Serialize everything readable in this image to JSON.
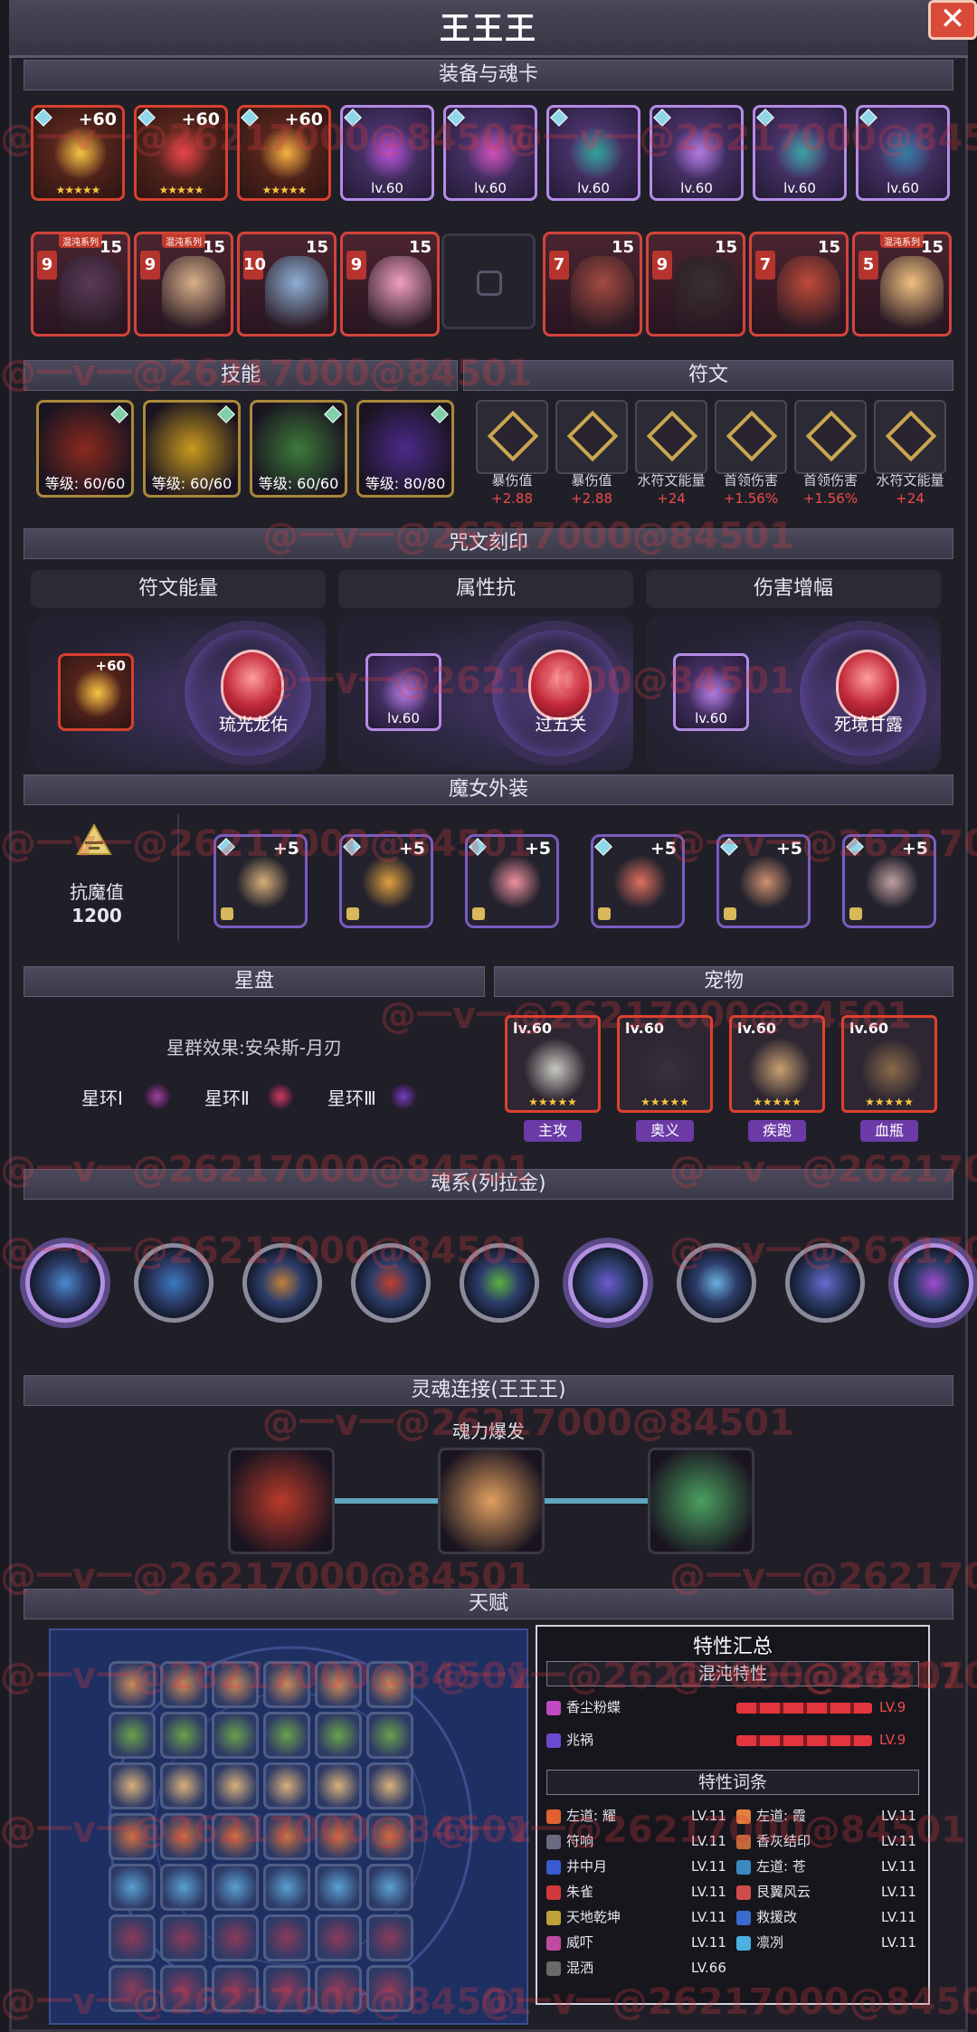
{
  "title": "王王王",
  "close_label": "✕",
  "sections": {
    "equip_soul": "装备与魂卡",
    "skills": "技能",
    "runes": "符文",
    "curse": "咒文刻印",
    "outfit": "魔女外装",
    "star": "星盘",
    "pet": "宠物",
    "soul_system": "魂系(列拉金)",
    "soul_link": "灵魂连接(王王王)",
    "talent": "天赋"
  },
  "gear": [
    {
      "label": "+60",
      "kind": "plus",
      "color": "#f5c542"
    },
    {
      "label": "+60",
      "kind": "plus",
      "color": "#e8434a"
    },
    {
      "label": "+60",
      "kind": "plus",
      "color": "#f5b342"
    },
    {
      "label": "lv.60",
      "kind": "lv",
      "color": "#b84fd6"
    },
    {
      "label": "lv.60",
      "kind": "lv",
      "color": "#d04fb8"
    },
    {
      "label": "lv.60",
      "kind": "lv",
      "color": "#2fa59a"
    },
    {
      "label": "lv.60",
      "kind": "lv",
      "color": "#b17be0"
    },
    {
      "label": "lv.60",
      "kind": "lv",
      "color": "#3aa3a3"
    },
    {
      "label": "lv.60",
      "kind": "lv",
      "color": "#2f7fa5"
    }
  ],
  "stars": "★★★★★",
  "souls_left": [
    {
      "num": "15",
      "badge": "9",
      "tag": "混沌系列",
      "face": "#5a3a58"
    },
    {
      "num": "15",
      "badge": "9",
      "tag": "混沌系列",
      "face": "#d9b08a"
    },
    {
      "num": "15",
      "badge": "10",
      "tag": "",
      "face": "#8fb0d6"
    },
    {
      "num": "15",
      "badge": "9",
      "tag": "",
      "face": "#f0a0c0"
    }
  ],
  "souls_right": [
    {
      "num": "15",
      "badge": "7",
      "tag": "",
      "face": "#a34a40"
    },
    {
      "num": "15",
      "badge": "9",
      "tag": "",
      "face": "#3a3030"
    },
    {
      "num": "15",
      "badge": "7",
      "tag": "",
      "face": "#c04a3a"
    },
    {
      "num": "15",
      "badge": "5",
      "tag": "混沌系列",
      "face": "#f0c080"
    }
  ],
  "skills": [
    {
      "level": "等级: 60/60",
      "color": "#8a2a1e"
    },
    {
      "level": "等级: 60/60",
      "color": "#c99a1e"
    },
    {
      "level": "等级: 60/60",
      "color": "#3c7a3a"
    },
    {
      "level": "等级: 80/80",
      "color": "#4b2a8a"
    }
  ],
  "runes": [
    {
      "label": "暴伤值",
      "value": "+2.88"
    },
    {
      "label": "暴伤值",
      "value": "+2.88"
    },
    {
      "label": "水符文能量",
      "value": "+24"
    },
    {
      "label": "首领伤害",
      "value": "+1.56%"
    },
    {
      "label": "首领伤害",
      "value": "+1.56%"
    },
    {
      "label": "水符文能量",
      "value": "+24"
    }
  ],
  "curse": [
    {
      "head": "符文能量",
      "item_label": "+60",
      "crystal": "琉光龙佑"
    },
    {
      "head": "属性抗",
      "item_label": "lv.60",
      "crystal": "过五关"
    },
    {
      "head": "伤害增幅",
      "item_label": "lv.60",
      "crystal": "死境甘露"
    }
  ],
  "resist": {
    "label": "抗魔值",
    "value": "1200"
  },
  "outfits": [
    {
      "plus": "+5",
      "color": "#d8b07a"
    },
    {
      "plus": "+5",
      "color": "#e0a040"
    },
    {
      "plus": "+5",
      "color": "#f090a0"
    },
    {
      "plus": "+5",
      "color": "#e07060"
    },
    {
      "plus": "+5",
      "color": "#d09070"
    },
    {
      "plus": "+5",
      "color": "#c0a0a0"
    }
  ],
  "star": {
    "effect": "星群效果:安朵斯-月刃",
    "rings": [
      "星环Ⅰ",
      "星环Ⅱ",
      "星环Ⅲ"
    ]
  },
  "pets": [
    {
      "lv": "lv.60",
      "tag": "主攻",
      "color": "#c9c9c0"
    },
    {
      "lv": "lv.60",
      "tag": "奥义",
      "color": "#3a3040"
    },
    {
      "lv": "lv.60",
      "tag": "疾跑",
      "color": "#c9a070"
    },
    {
      "lv": "lv.60",
      "tag": "血瓶",
      "color": "#8a6a4a"
    }
  ],
  "orbs": [
    {
      "color": "#4a8ad0",
      "fancy": true
    },
    {
      "color": "#3a7ac0",
      "fancy": false
    },
    {
      "color": "#c0803a",
      "fancy": false
    },
    {
      "color": "#c0402a",
      "fancy": false
    },
    {
      "color": "#5ab040",
      "fancy": false
    },
    {
      "color": "#6a5ad0",
      "fancy": true
    },
    {
      "color": "#6ab0e0",
      "fancy": false
    },
    {
      "color": "#6a6ad0",
      "fancy": false
    },
    {
      "color": "#a04ad0",
      "fancy": true
    }
  ],
  "soul_link": {
    "caption": "魂力爆发",
    "icons": [
      "#b83a2a",
      "#e0a060",
      "#4aa060"
    ]
  },
  "traits": {
    "title": "特性汇总",
    "chaos_head": "混沌特性",
    "chaos": [
      {
        "name": "香尘粉蝶",
        "lv": "LV.9",
        "color": "#c04ac0"
      },
      {
        "name": "兆祸",
        "lv": "LV.9",
        "color": "#6a4ad0"
      }
    ],
    "entries_head": "特性词条",
    "entries": [
      {
        "name": "左道: 耀",
        "lv": "LV.11",
        "color": "#e06030"
      },
      {
        "name": "左道: 霞",
        "lv": "LV.11",
        "color": "#e0803a"
      },
      {
        "name": "符响",
        "lv": "LV.11",
        "color": "#6a6a80"
      },
      {
        "name": "香灰结印",
        "lv": "LV.11",
        "color": "#c06a3a"
      },
      {
        "name": "井中月",
        "lv": "LV.11",
        "color": "#3a5ad0"
      },
      {
        "name": "左道: 苍",
        "lv": "LV.11",
        "color": "#3a8ac0"
      },
      {
        "name": "朱雀",
        "lv": "LV.11",
        "color": "#d03a3a"
      },
      {
        "name": "艮翼风云",
        "lv": "LV.11",
        "color": "#d04a4a"
      },
      {
        "name": "天地乾坤",
        "lv": "LV.11",
        "color": "#c0a03a"
      },
      {
        "name": "救援改",
        "lv": "LV.11",
        "color": "#3a6ad0"
      },
      {
        "name": "威吓",
        "lv": "LV.11",
        "color": "#c04aa0"
      },
      {
        "name": "凛冽",
        "lv": "LV.11",
        "color": "#4ab0e0"
      },
      {
        "name": "混洒",
        "lv": "LV.66",
        "color": "#6a6a6a"
      }
    ]
  },
  "watermark": "@一v一@26217000@84501"
}
